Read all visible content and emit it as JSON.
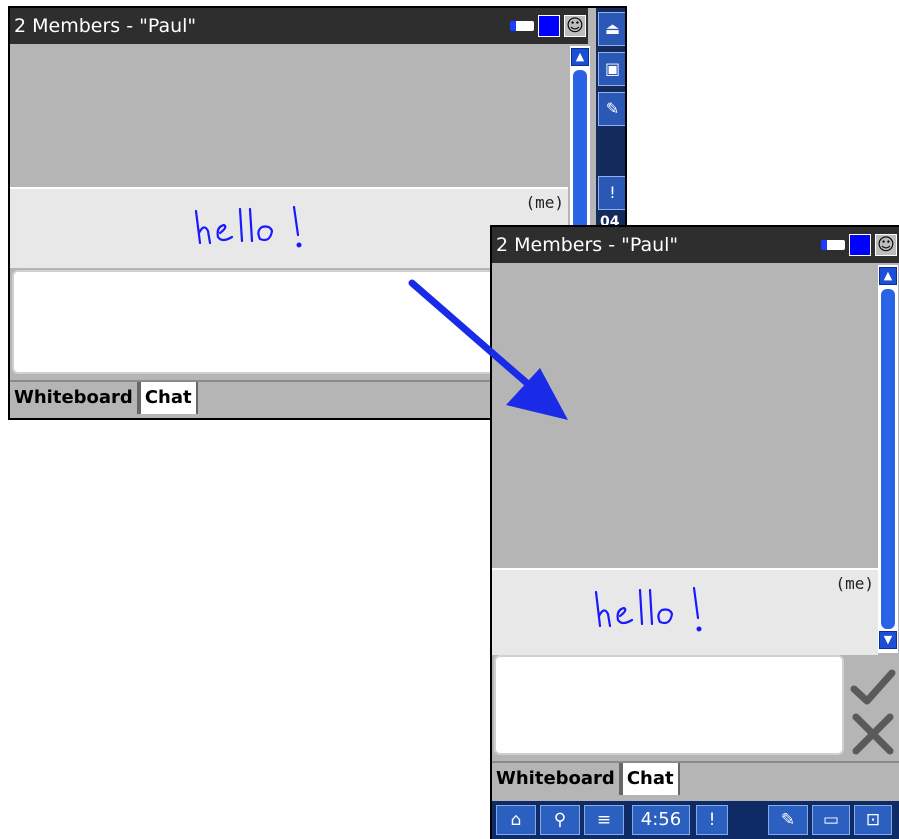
{
  "screens": [
    {
      "title": "2 Members - \"Paul\"",
      "message": {
        "author": "(me)",
        "ink_text": "hello!"
      },
      "tabs": [
        {
          "label": "Whiteboard",
          "active": false
        },
        {
          "label": "Chat",
          "active": true
        }
      ],
      "sidebar": {
        "buttons": [
          "exit-icon",
          "select-icon",
          "pen-icon",
          "alert-icon"
        ],
        "partial_text": "04"
      }
    },
    {
      "title": "2 Members - \"Paul\"",
      "message": {
        "author": "(me)",
        "ink_text": "hello!"
      },
      "tabs": [
        {
          "label": "Whiteboard",
          "active": false
        },
        {
          "label": "Chat",
          "active": true
        }
      ],
      "actions": {
        "send": "check-icon",
        "clear": "x-icon"
      },
      "status_bar": {
        "time": "4:56"
      }
    }
  ],
  "colors": {
    "title_bg": "#2e2e2e",
    "ink": "#1a1aff",
    "arrow": "#1a2be8",
    "accent": "#2b58b5"
  }
}
